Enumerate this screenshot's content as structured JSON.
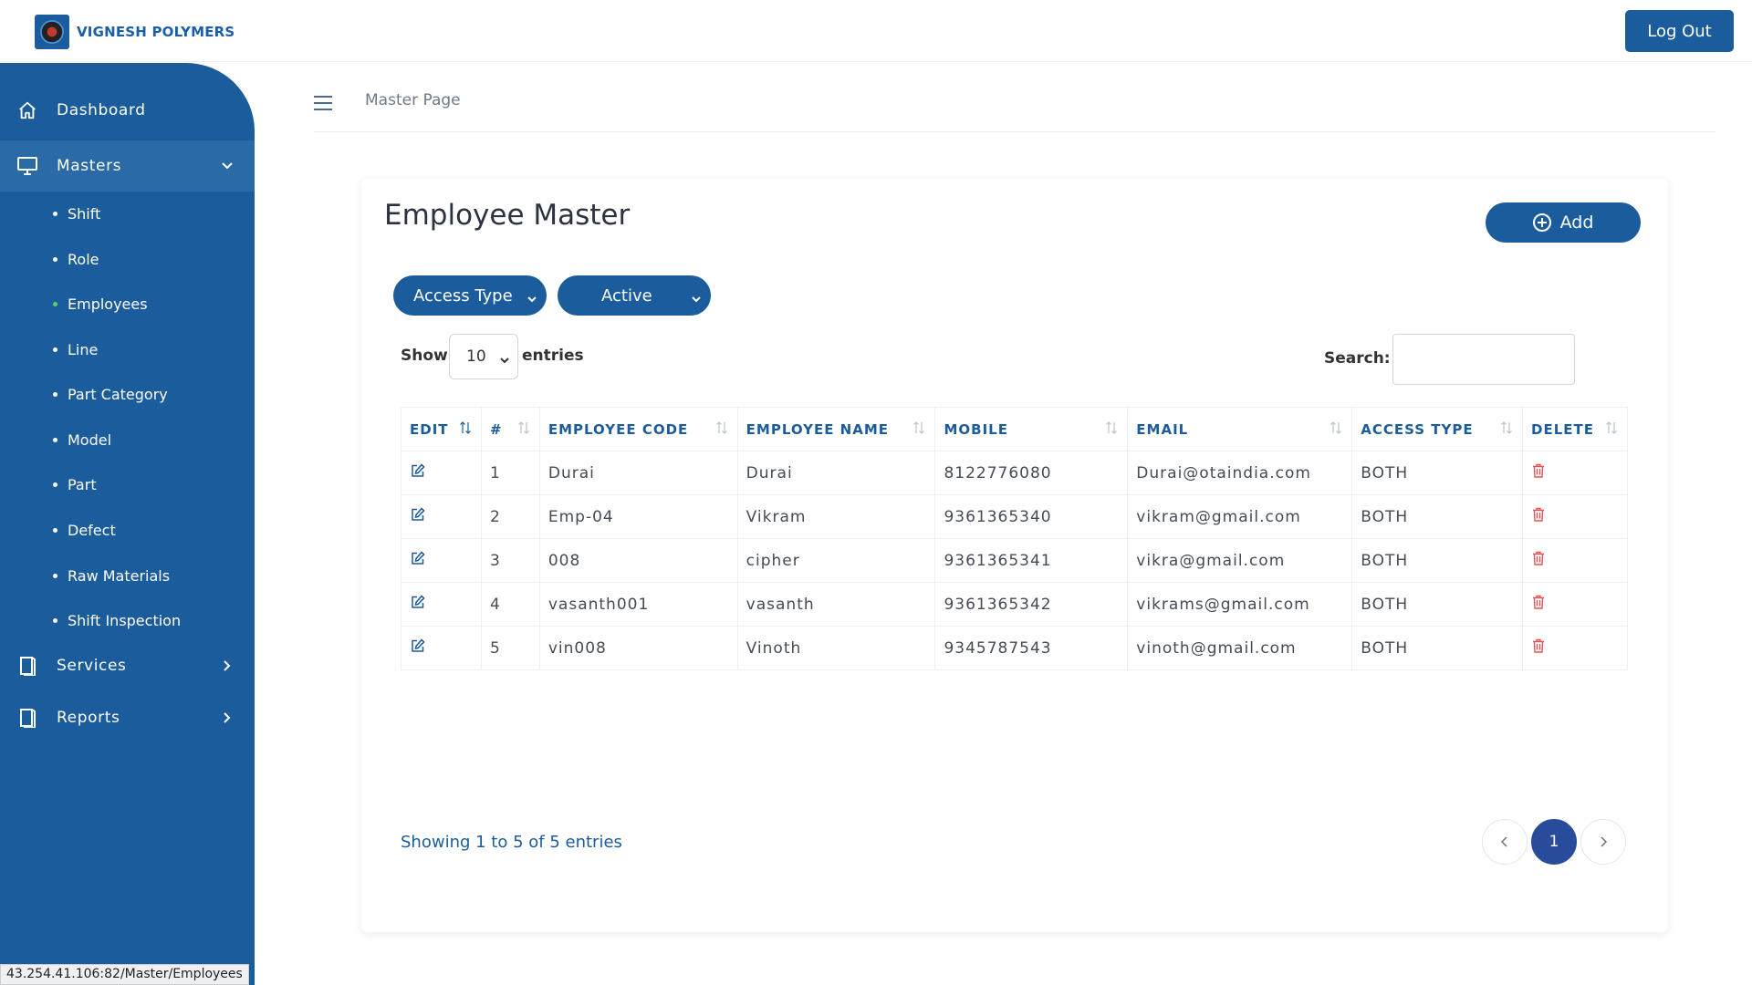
{
  "header": {
    "brand": "VIGNESH POLYMERS",
    "logout_label": "Log Out"
  },
  "sidebar": {
    "dashboard": "Dashboard",
    "masters": "Masters",
    "sub_items": [
      "Shift",
      "Role",
      "Employees",
      "Line",
      "Part Category",
      "Model",
      "Part",
      "Defect",
      "Raw Materials",
      "Shift Inspection"
    ],
    "current_sub": "Employees",
    "services": "Services",
    "reports": "Reports"
  },
  "breadcrumb": "Master Page",
  "card": {
    "title": "Employee Master",
    "add_label": "Add"
  },
  "filters": {
    "access_type": "Access Type",
    "status": "Active"
  },
  "length_menu": {
    "show": "Show",
    "value": "10",
    "entries": "entries"
  },
  "search": {
    "label": "Search:",
    "value": ""
  },
  "table": {
    "headers": [
      "EDIT",
      "#",
      "EMPLOYEE CODE",
      "EMPLOYEE NAME",
      "MOBILE",
      "EMAIL",
      "ACCESS TYPE",
      "DELETE"
    ],
    "rows": [
      {
        "num": "1",
        "code": "Durai",
        "name": "Durai",
        "mobile": "8122776080",
        "email": "Durai@otaindia.com",
        "access": "BOTH"
      },
      {
        "num": "2",
        "code": "Emp-04",
        "name": "Vikram",
        "mobile": "9361365340",
        "email": "vikram@gmail.com",
        "access": "BOTH"
      },
      {
        "num": "3",
        "code": "008",
        "name": "cipher",
        "mobile": "9361365341",
        "email": "vikra@gmail.com",
        "access": "BOTH"
      },
      {
        "num": "4",
        "code": "vasanth001",
        "name": "vasanth",
        "mobile": "9361365342",
        "email": "vikrams@gmail.com",
        "access": "BOTH"
      },
      {
        "num": "5",
        "code": "vin008",
        "name": "Vinoth",
        "mobile": "9345787543",
        "email": "vinoth@gmail.com",
        "access": "BOTH"
      }
    ]
  },
  "table_info": "Showing 1 to 5 of 5 entries",
  "pagination": {
    "current_page": "1"
  },
  "status_url": "43.254.41.106:82/Master/Employees",
  "colors": {
    "primary": "#1b5c9c",
    "pager_active": "#284c9b",
    "delete_icon": "#e05555",
    "current_dot": "#5ad06b"
  }
}
